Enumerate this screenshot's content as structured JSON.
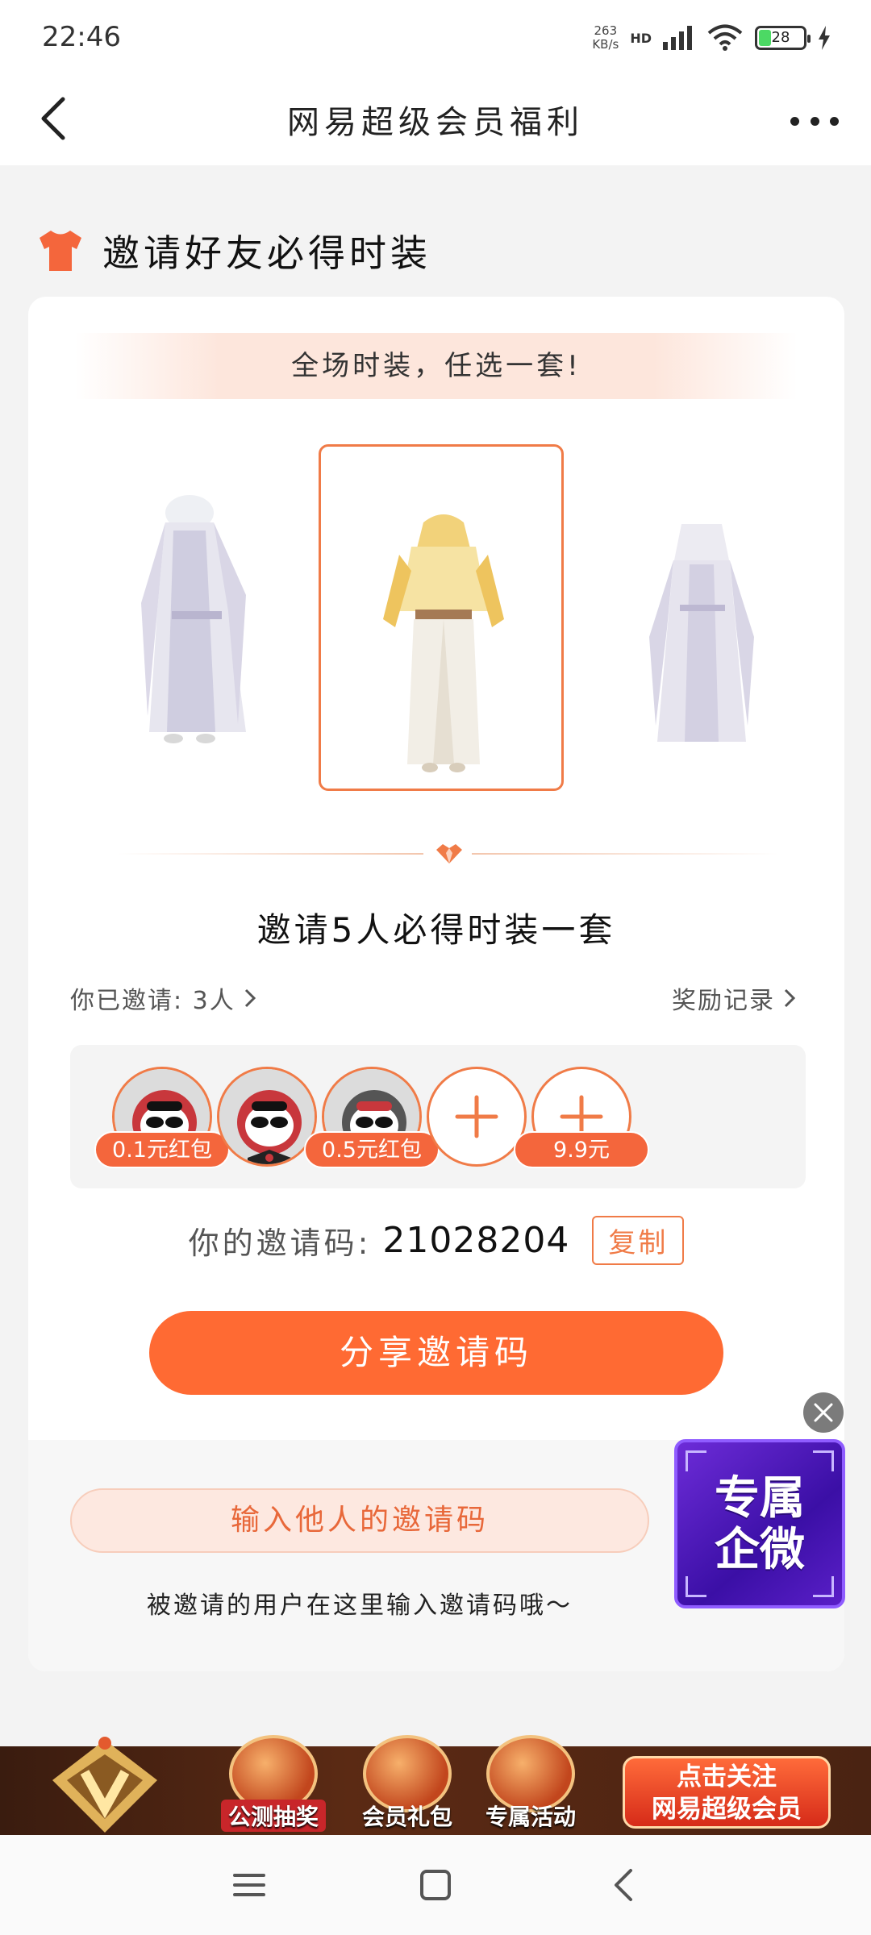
{
  "status_bar": {
    "time": "22:46",
    "net_speed": "263",
    "net_unit": "KB/s",
    "hd": "HD",
    "battery": "28",
    "battery_level": 0.28
  },
  "header": {
    "title": "网易超级会员福利"
  },
  "section": {
    "title": "邀请好友必得时装",
    "icon": "tshirt-icon"
  },
  "card": {
    "banner": "全场时装，任选一套!",
    "goal": "邀请5人必得时装一套",
    "invited_label": "你已邀请: 3人",
    "records_label": "奖励记录",
    "slots": [
      {
        "reward": "0.1元红包"
      },
      {
        "reward": ""
      },
      {
        "reward": "0.5元红包"
      },
      {
        "reward": ""
      },
      {
        "reward": "9.9元"
      }
    ],
    "code_label": "你的邀请码:",
    "code": "21028204",
    "copy_label": "复制",
    "share_label": "分享邀请码",
    "input_label": "输入他人的邀请码",
    "hint": "被邀请的用户在这里输入邀请码哦～"
  },
  "float_promo": {
    "line1": "专属",
    "line2": "企微"
  },
  "promo_bar": {
    "items": [
      "公测抽奖",
      "会员礼包",
      "专属活动"
    ],
    "follow_line1": "点击关注",
    "follow_line2": "网易超级会员"
  },
  "colors": {
    "accent": "#ff6a33",
    "accent_border": "#f07b47",
    "promo_purple": "#4b16b8"
  }
}
